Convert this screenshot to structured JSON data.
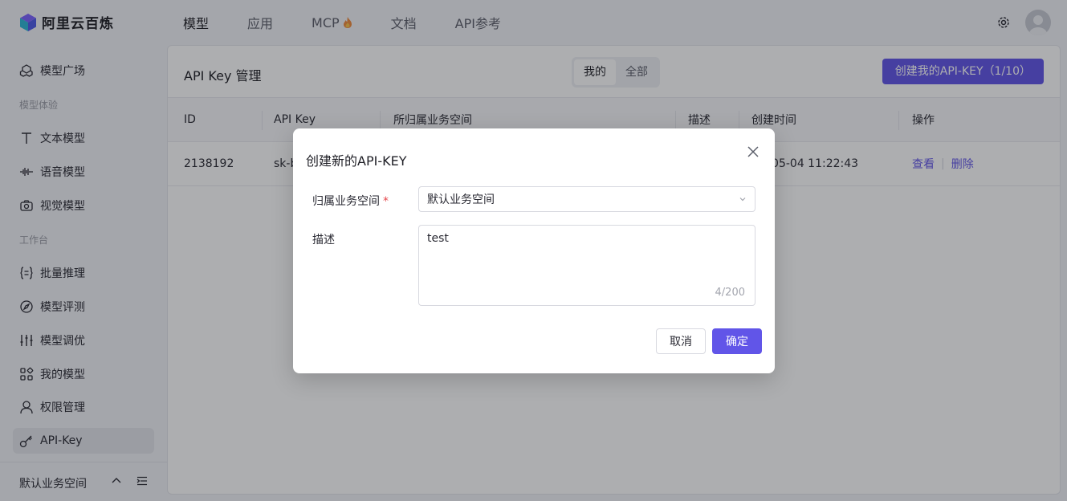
{
  "brand": {
    "name": "阿里云百炼"
  },
  "nav": [
    {
      "label": "模型"
    },
    {
      "label": "应用"
    },
    {
      "label": "MCP"
    },
    {
      "label": "文档"
    },
    {
      "label": "API参考"
    }
  ],
  "sidebar": {
    "items": [
      {
        "label": "模型广场"
      },
      {
        "label": "文本模型"
      },
      {
        "label": "语音模型"
      },
      {
        "label": "视觉模型"
      },
      {
        "label": "批量推理"
      },
      {
        "label": "模型评测"
      },
      {
        "label": "模型调优"
      },
      {
        "label": "我的模型"
      },
      {
        "label": "权限管理"
      },
      {
        "label": "API-Key"
      }
    ],
    "groups": [
      "模型体验",
      "工作台"
    ],
    "workspace": "默认业务空间"
  },
  "main": {
    "title": "API Key 管理",
    "segments": [
      "我的",
      "全部"
    ],
    "create_button": "创建我的API-KEY（1/10）",
    "columns": [
      "ID",
      "API Key",
      "所归属业务空间",
      "描述",
      "创建时间",
      "操作"
    ],
    "rows": [
      {
        "id": "2138192",
        "key": "sk-b",
        "time": "-05-04 11:22:43",
        "view": "查看",
        "delete": "删除"
      }
    ]
  },
  "modal": {
    "title": "创建新的API-KEY",
    "workspace_label": "归属业务空间",
    "required_mark": "*",
    "workspace_value": "默认业务空间",
    "desc_label": "描述",
    "desc_value": "test",
    "counter": "4/200",
    "cancel": "取消",
    "ok": "确定"
  },
  "colors": {
    "accent": "#6155e8",
    "fire": "#f08a3c"
  }
}
